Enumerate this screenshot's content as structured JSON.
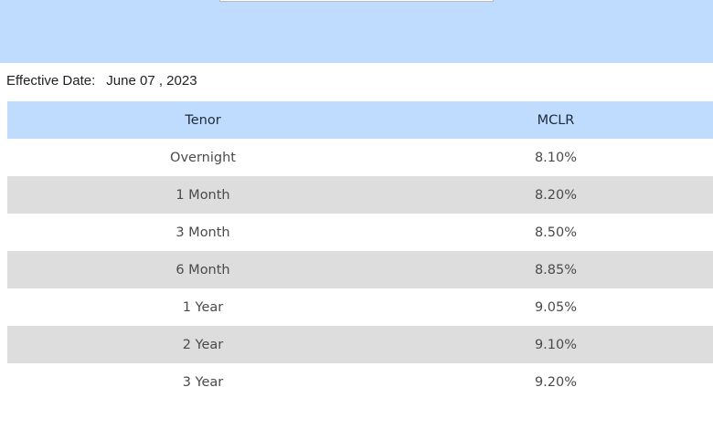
{
  "header": {
    "effective_date_label": "Effective Date:",
    "effective_date_value": "June 07 , 2023"
  },
  "table": {
    "columns": [
      "Tenor",
      "MCLR"
    ],
    "rows": [
      {
        "tenor": "Overnight",
        "mclr": "8.10%"
      },
      {
        "tenor": "1 Month",
        "mclr": "8.20%"
      },
      {
        "tenor": "3 Month",
        "mclr": "8.50%"
      },
      {
        "tenor": "6 Month",
        "mclr": "8.85%"
      },
      {
        "tenor": "1 Year",
        "mclr": "9.05%"
      },
      {
        "tenor": "2 Year",
        "mclr": "9.10%"
      },
      {
        "tenor": "3 Year",
        "mclr": "9.20%"
      }
    ]
  },
  "colors": {
    "header_bg": "#bfdcff",
    "stripe_bg": "#dddddd"
  }
}
